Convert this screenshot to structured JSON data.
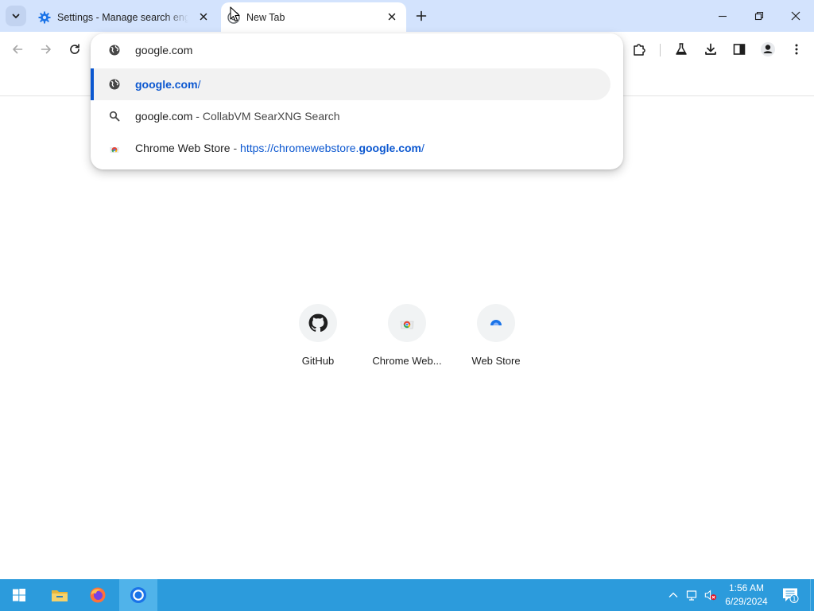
{
  "colors": {
    "tabstrip": "#d3e3fd",
    "accent": "#0b57d0",
    "taskbar": "#2c9bdc"
  },
  "tabs": [
    {
      "title": "Settings - Manage search engines and site search",
      "favicon": "gear-icon",
      "active": false
    },
    {
      "title": "New Tab",
      "favicon": "chrome-logo-icon",
      "active": true
    }
  ],
  "omnibox": {
    "input_value": "google.com",
    "suggestions": [
      {
        "icon": "globe-icon",
        "url_bold": "google.com",
        "url_rest": "/",
        "selected": true
      },
      {
        "icon": "search-icon",
        "query": "google.com",
        "separator": " - ",
        "description": "CollabVM SearXNG Search"
      },
      {
        "icon": "chrome-web-store-icon",
        "title": "Chrome Web Store",
        "separator": " - ",
        "url_prefix": "https://chromewebstore.",
        "url_bold": "google.com",
        "url_suffix": "/"
      }
    ]
  },
  "shortcuts": [
    {
      "label": "GitHub",
      "icon": "github-icon"
    },
    {
      "label": "Chrome Web...",
      "icon": "chrome-web-store-icon"
    },
    {
      "label": "Web Store",
      "icon": "web-store-icon"
    }
  ],
  "taskbar": {
    "apps": [
      "start-button",
      "file-explorer",
      "firefox",
      "chrome"
    ],
    "clock_time": "1:56 AM",
    "clock_date": "6/29/2024",
    "notification_count": "1"
  }
}
